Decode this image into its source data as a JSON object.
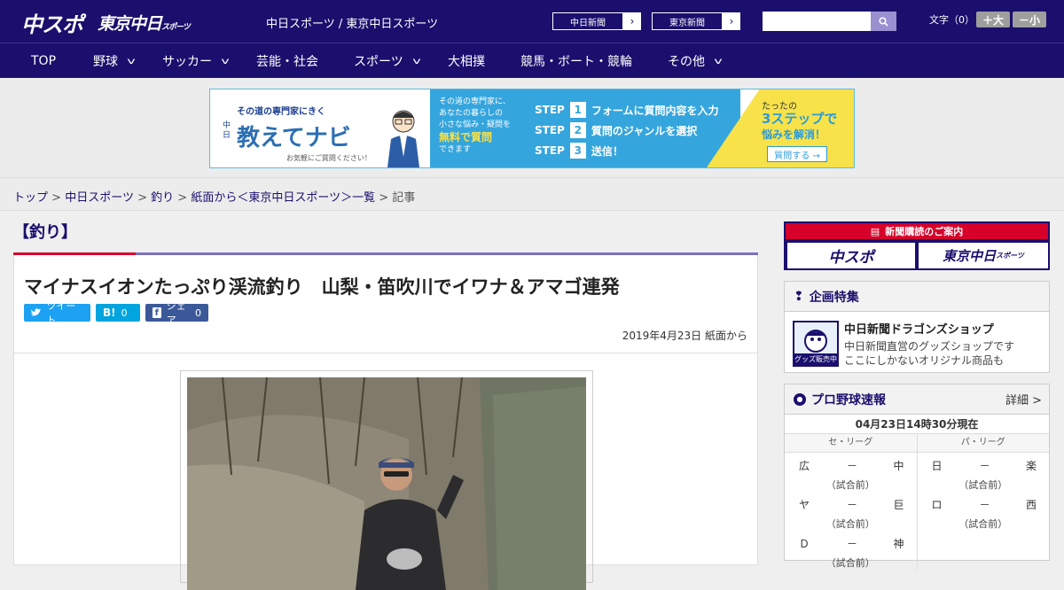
{
  "header": {
    "logo_main": "中スポ",
    "logo_sub": "東京中日",
    "logo_sub_small": "スポーツ",
    "site_name": "中日スポーツ / 東京中日スポーツ",
    "paper_links": [
      "中日新聞",
      "東京新聞"
    ],
    "search_placeholder": "",
    "font_size_label": "文字（0）",
    "font_larger": "＋大",
    "font_smaller": "－小"
  },
  "nav": [
    {
      "label": "TOP",
      "dropdown": false
    },
    {
      "label": "野球",
      "dropdown": true
    },
    {
      "label": "サッカー",
      "dropdown": true
    },
    {
      "label": "芸能・社会",
      "dropdown": false
    },
    {
      "label": "スポーツ",
      "dropdown": true
    },
    {
      "label": "大相撲",
      "dropdown": false
    },
    {
      "label": "競馬・ボート・競輪",
      "dropdown": false
    },
    {
      "label": "その他",
      "dropdown": true
    }
  ],
  "ad": {
    "tagline": "その道の専門家にきく",
    "brand": "教えてナビ",
    "brand_prefix": "中日",
    "note": "お気軽にご質問ください！",
    "mid_text": [
      "その道の専門家に、",
      "あなたの暮らしの",
      "小さな悩み・疑問を",
      "無料で質問",
      "できます"
    ],
    "steps": [
      {
        "num": "1",
        "text": "フォームに質問内容を入力"
      },
      {
        "num": "2",
        "text": "質問のジャンルを選択"
      },
      {
        "num": "3",
        "text": "送信！"
      }
    ],
    "step_label": "STEP",
    "promo_small": "たったの",
    "promo_big": "3ステップで",
    "promo_line": "悩みを解消！",
    "cta": "質問する →"
  },
  "breadcrumb": {
    "items": [
      "トップ",
      "中日スポーツ",
      "釣り",
      "紙面から＜東京中日スポーツ＞一覧"
    ],
    "current": "記事",
    "separator": ">"
  },
  "article": {
    "category": "【釣り】",
    "title": "マイナスイオンたっぷり渓流釣り　山梨・笛吹川でイワナ＆アマゴ連発",
    "share": {
      "tweet": "ツイート",
      "hatena_label": "B!",
      "hatena_count": "0",
      "facebook": "シェア",
      "facebook_count": "0"
    },
    "date": "2019年4月23日 紙面から"
  },
  "sidebar": {
    "subscribe_title": "新聞購読のご案内",
    "subscribe_left": "中スポ",
    "subscribe_right": "東京中日",
    "subscribe_right_small": "スポーツ",
    "feature_title": "企画特集",
    "shop_badge": "グッズ販売中",
    "shop_title": "中日新聞ドラゴンズショップ",
    "shop_desc1": "中日新聞直営のグッズショップです",
    "shop_desc2": "ここにしかないオリジナル商品も",
    "baseball_title": "プロ野球速報",
    "baseball_detail": "詳細 >",
    "baseball_time": "04月23日14時30分現在",
    "league_central": "セ・リーグ",
    "league_pacific": "パ・リーグ",
    "central_games": [
      {
        "home": "広",
        "away": "中",
        "score": "－",
        "status": "（試合前）"
      },
      {
        "home": "ヤ",
        "away": "巨",
        "score": "－",
        "status": "（試合前）"
      },
      {
        "home": "Ｄ",
        "away": "神",
        "score": "－",
        "status": "（試合前）"
      }
    ],
    "pacific_games": [
      {
        "home": "日",
        "away": "楽",
        "score": "－",
        "status": "（試合前）"
      },
      {
        "home": "ロ",
        "away": "西",
        "score": "－",
        "status": "（試合前）"
      }
    ]
  },
  "colors": {
    "brand_navy": "#1a0f6d",
    "accent_red": "#d6002a",
    "twitter": "#1da1f2",
    "hatena": "#00a4de",
    "facebook": "#3b5998"
  }
}
